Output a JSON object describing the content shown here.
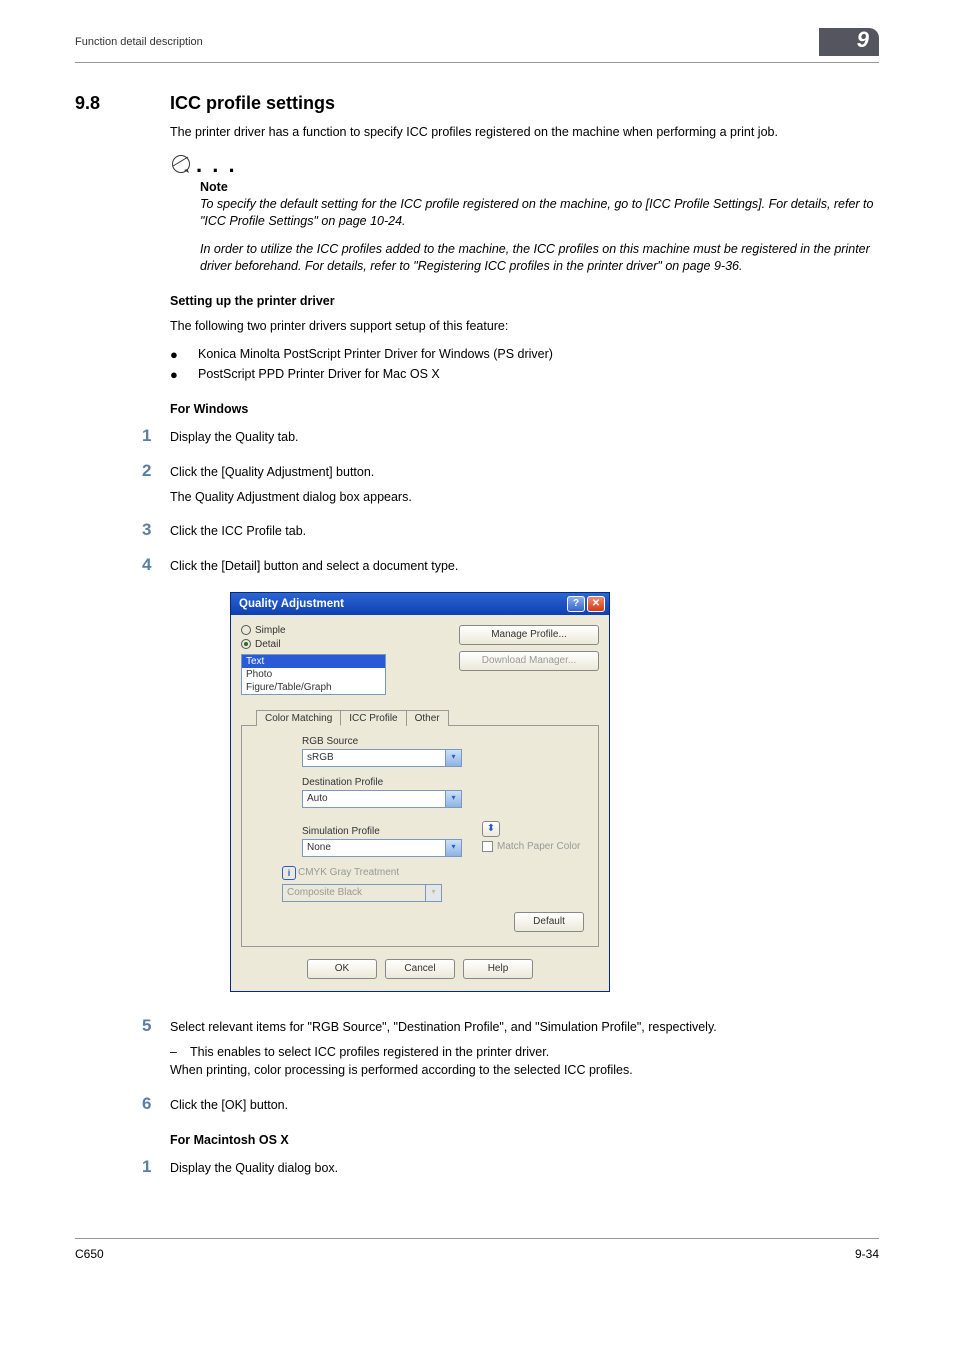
{
  "header": {
    "left": "Function detail description",
    "chapter": "9"
  },
  "section": {
    "number": "9.8",
    "title": "ICC profile settings"
  },
  "intro_para": "The printer driver has a function to specify ICC profiles registered on the machine when performing a print job.",
  "note": {
    "label": "Note",
    "p1": "To specify the default setting for the ICC profile registered on the machine, go to [ICC Profile Settings]. For details, refer to \"ICC Profile Settings\" on page 10-24.",
    "p2": "In order to utilize the ICC profiles added to the machine, the ICC profiles on this machine must be registered in the printer driver beforehand. For details, refer to \"Registering ICC profiles in the printer driver\" on page 9-36."
  },
  "setup": {
    "head": "Setting up the printer driver",
    "intro": "The following two printer drivers support setup of this feature:",
    "bullets": [
      "Konica Minolta PostScript Printer Driver for Windows (PS driver)",
      "PostScript PPD Printer Driver for Mac OS X"
    ]
  },
  "windows": {
    "head": "For Windows",
    "steps": {
      "1": "Display the Quality tab.",
      "2": "Click the [Quality Adjustment] button.",
      "2_sub": "The Quality Adjustment dialog box appears.",
      "3": "Click the ICC Profile tab.",
      "4": "Click the [Detail] button and select a document type.",
      "5": "Select relevant items for \"RGB Source\", \"Destination Profile\", and \"Simulation Profile\", respectively.",
      "5_dash": "This enables to select ICC profiles registered in the printer driver.",
      "5_sub": "When printing, color processing is performed according to the selected ICC profiles.",
      "6": "Click the [OK] button."
    }
  },
  "mac": {
    "head": "For Macintosh OS X",
    "steps": {
      "1": "Display the Quality dialog box."
    }
  },
  "dialog": {
    "title": "Quality Adjustment",
    "radios": {
      "simple": "Simple",
      "detail": "Detail"
    },
    "buttons": {
      "manage": "Manage Profile...",
      "download": "Download Manager...",
      "default": "Default",
      "ok": "OK",
      "cancel": "Cancel",
      "help": "Help"
    },
    "list": [
      "Text",
      "Photo",
      "Figure/Table/Graph"
    ],
    "tabs": {
      "cm": "Color Matching",
      "icc": "ICC Profile",
      "other": "Other"
    },
    "fields": {
      "rgb_label": "RGB Source",
      "rgb_value": "sRGB",
      "dest_label": "Destination Profile",
      "dest_value": "Auto",
      "sim_label": "Simulation Profile",
      "sim_value": "None",
      "match_paper": "Match Paper Color",
      "cmyk_label": "CMYK Gray Treatment",
      "cmyk_value": "Composite Black"
    }
  },
  "footer": {
    "left": "C650",
    "right": "9-34"
  }
}
